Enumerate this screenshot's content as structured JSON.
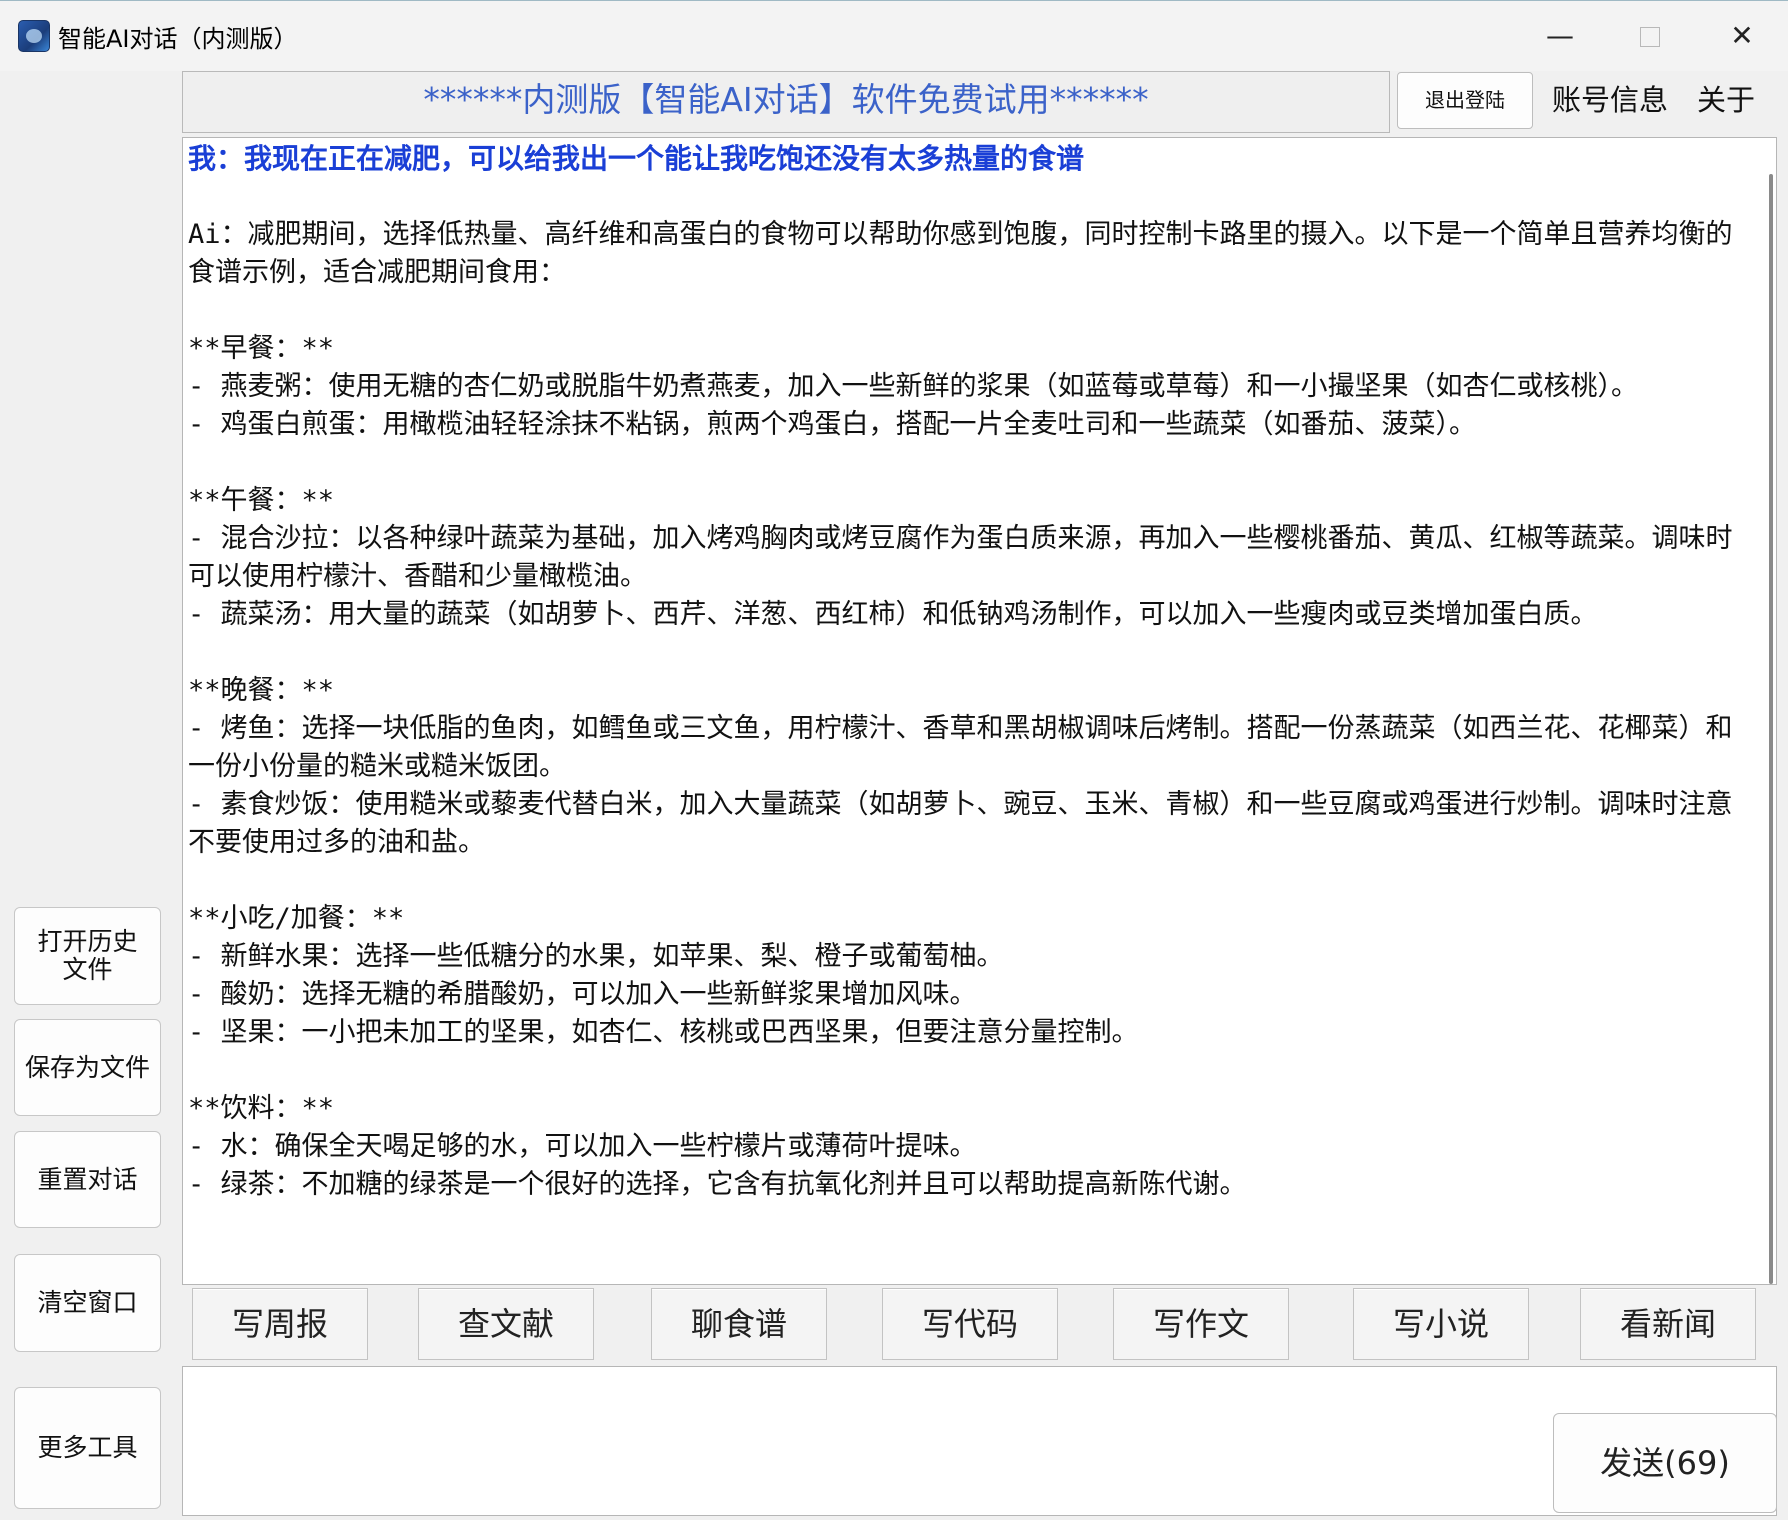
{
  "window": {
    "title": "智能AI对话（内测版）",
    "minimize_symbol": "—",
    "close_symbol": "✕"
  },
  "header": {
    "banner": "******内测版【智能AI对话】软件免费试用******",
    "logout": "退出登陆",
    "account_info": "账号信息",
    "about": "关于"
  },
  "chat": {
    "user_message": "我：我现在正在减肥，可以给我出一个能让我吃饱还没有太多热量的食谱",
    "ai_message": "Ai：减肥期间，选择低热量、高纤维和高蛋白的食物可以帮助你感到饱腹，同时控制卡路里的摄入。以下是一个简单且营养均衡的食谱示例，适合减肥期间食用：\n\n**早餐：**\n- 燕麦粥：使用无糖的杏仁奶或脱脂牛奶煮燕麦，加入一些新鲜的浆果（如蓝莓或草莓）和一小撮坚果（如杏仁或核桃）。\n- 鸡蛋白煎蛋：用橄榄油轻轻涂抹不粘锅，煎两个鸡蛋白，搭配一片全麦吐司和一些蔬菜（如番茄、菠菜）。\n\n**午餐：**\n- 混合沙拉：以各种绿叶蔬菜为基础，加入烤鸡胸肉或烤豆腐作为蛋白质来源，再加入一些樱桃番茄、黄瓜、红椒等蔬菜。调味时可以使用柠檬汁、香醋和少量橄榄油。\n- 蔬菜汤：用大量的蔬菜（如胡萝卜、西芹、洋葱、西红柿）和低钠鸡汤制作，可以加入一些瘦肉或豆类增加蛋白质。\n\n**晚餐：**\n- 烤鱼：选择一块低脂的鱼肉，如鳕鱼或三文鱼，用柠檬汁、香草和黑胡椒调味后烤制。搭配一份蒸蔬菜（如西兰花、花椰菜）和一份小份量的糙米或糙米饭团。\n- 素食炒饭：使用糙米或藜麦代替白米，加入大量蔬菜（如胡萝卜、豌豆、玉米、青椒）和一些豆腐或鸡蛋进行炒制。调味时注意不要使用过多的油和盐。\n\n**小吃/加餐：**\n- 新鲜水果：选择一些低糖分的水果，如苹果、梨、橙子或葡萄柚。\n- 酸奶：选择无糖的希腊酸奶，可以加入一些新鲜浆果增加风味。\n- 坚果：一小把未加工的坚果，如杏仁、核桃或巴西坚果，但要注意分量控制。\n\n**饮料：**\n- 水：确保全天喝足够的水，可以加入一些柠檬片或薄荷叶提味。\n- 绿茶：不加糖的绿茶是一个很好的选择，它含有抗氧化剂并且可以帮助提高新陈代谢。"
  },
  "quick_actions": [
    "写周报",
    "查文献",
    "聊食谱",
    "写代码",
    "写作文",
    "写小说",
    "看新闻"
  ],
  "sidebar": {
    "open_history_line1": "打开历史",
    "open_history_line2": "文件",
    "save_file": "保存为文件",
    "reset_chat": "重置对话",
    "clear_window": "清空窗口",
    "more_tools": "更多工具"
  },
  "input": {
    "value": "",
    "send_label": "发送(69)"
  }
}
